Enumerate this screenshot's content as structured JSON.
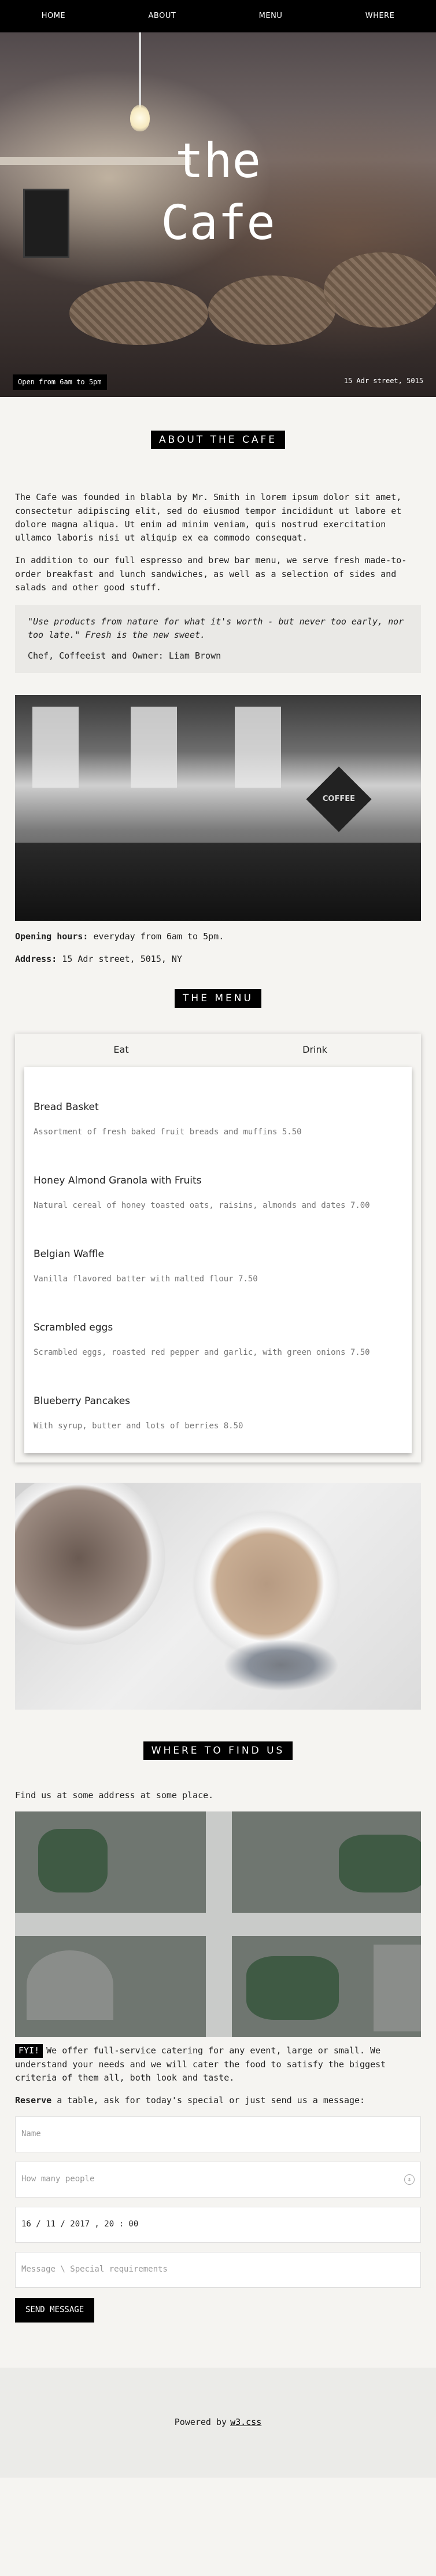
{
  "nav": {
    "items": [
      "HOME",
      "ABOUT",
      "MENU",
      "WHERE"
    ]
  },
  "hero": {
    "title_line1": "the",
    "title_line2": "Cafe",
    "open": "Open from 6am to 5pm",
    "address": "15 Adr street, 5015"
  },
  "about": {
    "title": "ABOUT THE CAFE",
    "p1": "The Cafe was founded in blabla by Mr. Smith in lorem ipsum dolor sit amet, consectetur adipiscing elit, sed do eiusmod tempor incididunt ut labore et dolore magna aliqua. Ut enim ad minim veniam, quis nostrud exercitation ullamco laboris nisi ut aliquip ex ea commodo consequat.",
    "p2": "In addition to our full espresso and brew bar menu, we serve fresh made-to-order breakfast and lunch sandwiches, as well as a selection of sides and salads and other good stuff.",
    "quote": "\"Use products from nature for what it's worth - but never too early, nor too late.\"",
    "quote_tail": " Fresh is the new sweet.",
    "quote_author": "Chef, Coffeeist and Owner: Liam Brown",
    "image_sign": "COFFEE",
    "hours_label": "Opening hours:",
    "hours": " everyday from 6am to 5pm.",
    "address_label": "Address:",
    "address": " 15 Adr street, 5015, NY"
  },
  "menu": {
    "title": "THE MENU",
    "tabs": [
      "Eat",
      "Drink"
    ],
    "items": [
      {
        "name": "Bread Basket",
        "desc": "Assortment of fresh baked fruit breads and muffins 5.50"
      },
      {
        "name": "Honey Almond Granola with Fruits",
        "desc": "Natural cereal of honey toasted oats, raisins, almonds and dates 7.00"
      },
      {
        "name": "Belgian Waffle",
        "desc": "Vanilla flavored batter with malted flour 7.50"
      },
      {
        "name": "Scrambled eggs",
        "desc": "Scrambled eggs, roasted red pepper and garlic, with green onions 7.50"
      },
      {
        "name": "Blueberry Pancakes",
        "desc": "With syrup, butter and lots of berries 8.50"
      }
    ]
  },
  "where": {
    "title": "WHERE TO FIND US",
    "intro": "Find us at some address at some place.",
    "fyi": "FYI!",
    "fyi_text": "We offer full-service catering for any event, large or small. We understand your needs and we will cater the food to satisfy the biggest criteria of them all, both look and taste.",
    "reserve_bold": "Reserve",
    "reserve_text": " a table, ask for today's special or just send us a message:",
    "name_placeholder": "Name",
    "people_placeholder": "How many people",
    "date_value": "16 / 11 / 2017 ,  20 : 00",
    "message_placeholder": "Message \\ Special requirements",
    "send": "SEND MESSAGE"
  },
  "footer": {
    "text": "Powered by",
    "link": "w3.css"
  }
}
